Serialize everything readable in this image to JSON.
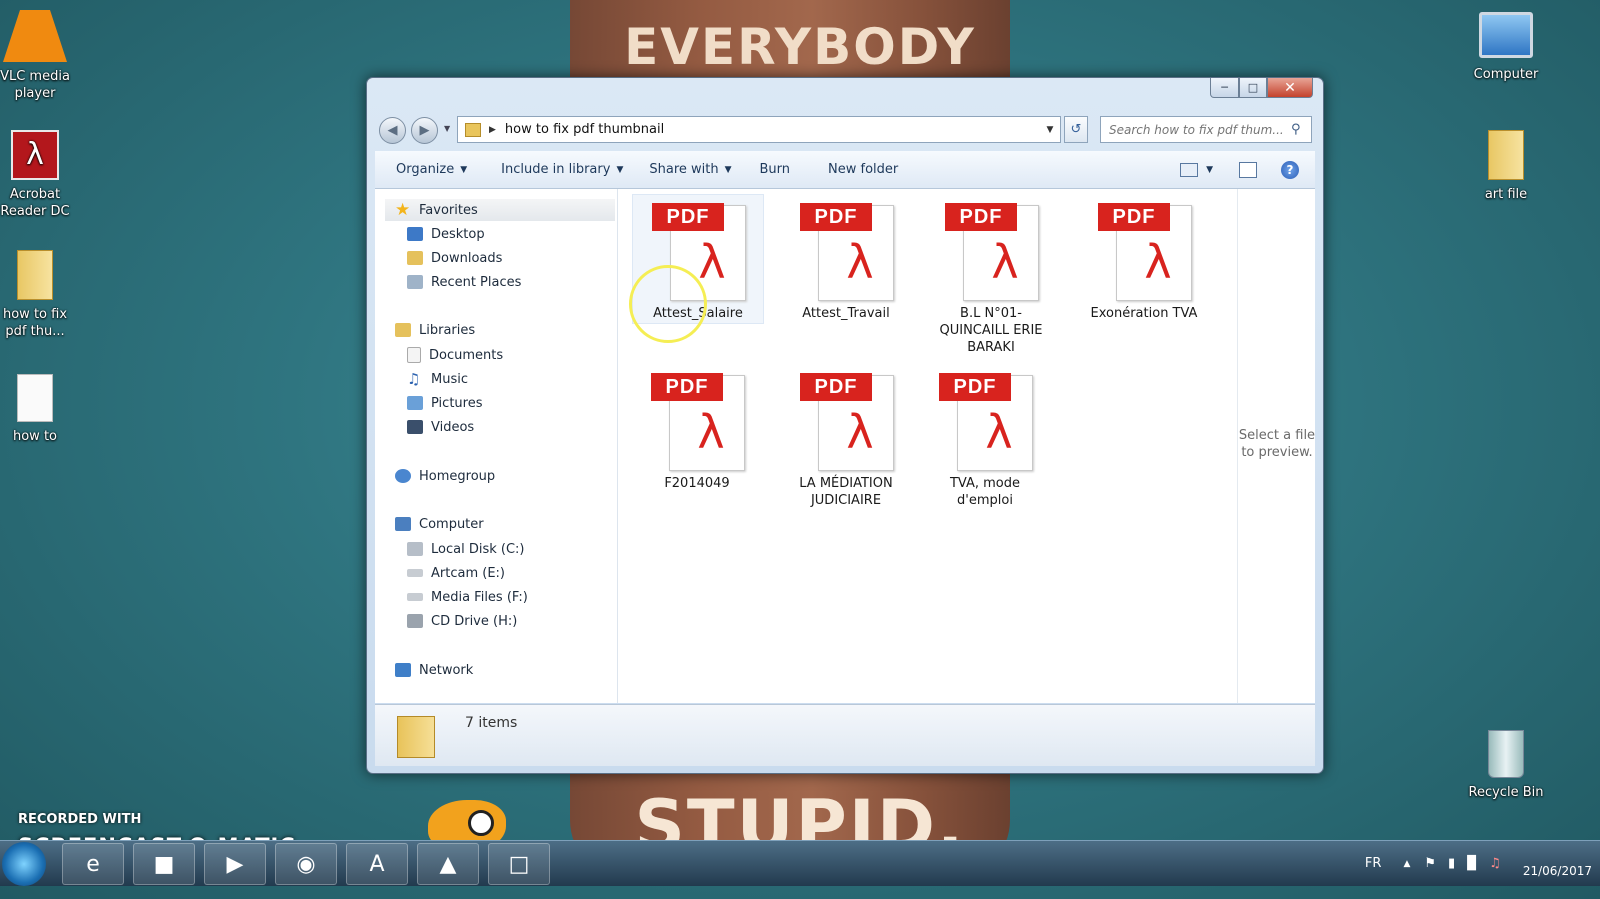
{
  "wallpaper": {
    "top_text": "EVERYBODY",
    "bottom_text": "STUPID."
  },
  "desktop_icons": {
    "vlc": "VLC media player",
    "acrobat": "Acrobat Reader DC",
    "folder": "how to fix pdf thu...",
    "howto": "how to",
    "computer": "Computer",
    "art_file": "art file",
    "recycle": "Recycle Bin"
  },
  "window": {
    "address_path": "how to fix pdf thumbnail",
    "search_placeholder": "Search how to fix pdf thum...",
    "toolbar": {
      "organize": "Organize",
      "include": "Include in library",
      "share": "Share with",
      "burn": "Burn",
      "new_folder": "New folder"
    },
    "nav": {
      "favorites": "Favorites",
      "desktop": "Desktop",
      "downloads": "Downloads",
      "recent": "Recent Places",
      "libraries": "Libraries",
      "documents": "Documents",
      "music": "Music",
      "pictures": "Pictures",
      "videos": "Videos",
      "homegroup": "Homegroup",
      "computer": "Computer",
      "local_disk": "Local Disk (C:)",
      "artcam": "Artcam  (E:)",
      "media_files": "Media Files (F:)",
      "cd_drive": "CD Drive (H:)",
      "network": "Network"
    },
    "files": [
      {
        "name": "Attest_Salaire",
        "badge": "PDF"
      },
      {
        "name": "Attest_Travail",
        "badge": "PDF"
      },
      {
        "name": "B.L N°01-QUINCAILL ERIE BARAKI",
        "badge": "PDF"
      },
      {
        "name": "Exonération TVA",
        "badge": "PDF"
      },
      {
        "name": "F2014049",
        "badge": "PDF"
      },
      {
        "name": "LA MÉDIATION JUDICIAIRE",
        "badge": "PDF"
      },
      {
        "name": "TVA, mode d'emploi",
        "badge": "PDF"
      }
    ],
    "preview_text": "Select a file to preview.",
    "item_count": "7 items"
  },
  "overlay": {
    "recorded": "RECORDED WITH",
    "brand": "SCREENCAST-O-MATIC"
  },
  "taskbar": {
    "lang": "FR",
    "date": "21/06/2017"
  }
}
